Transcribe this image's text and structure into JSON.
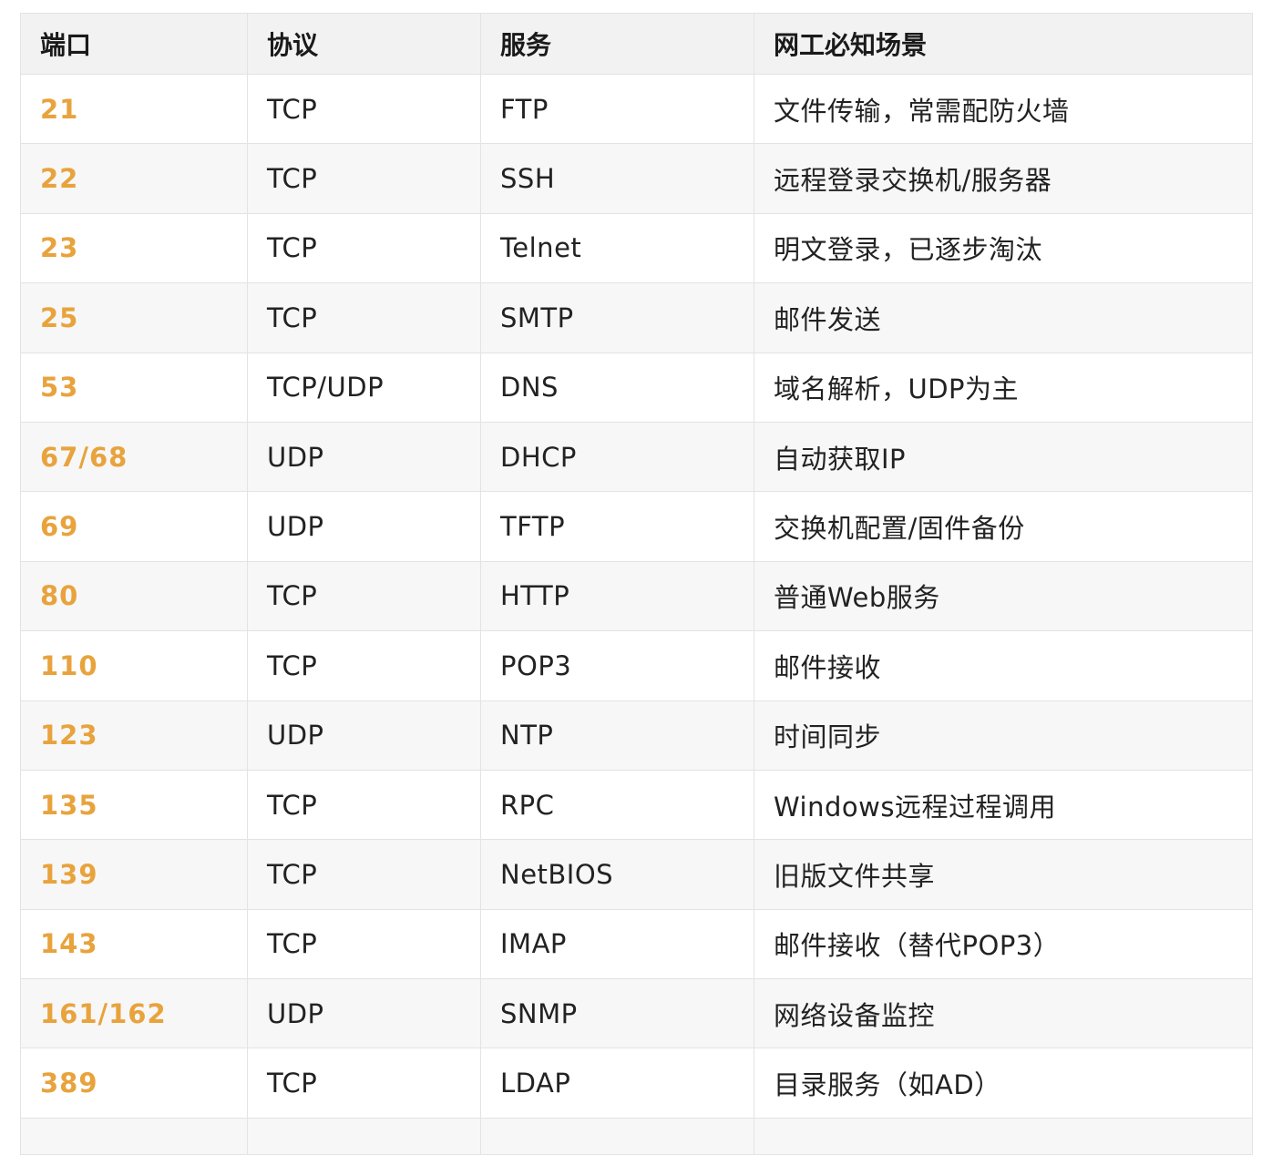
{
  "table": {
    "headers": [
      "端口",
      "协议",
      "服务",
      "网工必知场景"
    ],
    "accent_color": "#e8a33d",
    "rows": [
      {
        "port": "21",
        "protocol": "TCP",
        "service": "FTP",
        "scenario": "文件传输，常需配防火墙"
      },
      {
        "port": "22",
        "protocol": "TCP",
        "service": "SSH",
        "scenario": "远程登录交换机/服务器"
      },
      {
        "port": "23",
        "protocol": "TCP",
        "service": "Telnet",
        "scenario": "明文登录，已逐步淘汰"
      },
      {
        "port": "25",
        "protocol": "TCP",
        "service": "SMTP",
        "scenario": "邮件发送"
      },
      {
        "port": "53",
        "protocol": "TCP/UDP",
        "service": "DNS",
        "scenario": "域名解析，UDP为主"
      },
      {
        "port": "67/68",
        "protocol": "UDP",
        "service": "DHCP",
        "scenario": "自动获取IP"
      },
      {
        "port": "69",
        "protocol": "UDP",
        "service": "TFTP",
        "scenario": "交换机配置/固件备份"
      },
      {
        "port": "80",
        "protocol": "TCP",
        "service": "HTTP",
        "scenario": "普通Web服务"
      },
      {
        "port": "110",
        "protocol": "TCP",
        "service": "POP3",
        "scenario": "邮件接收"
      },
      {
        "port": "123",
        "protocol": "UDP",
        "service": "NTP",
        "scenario": "时间同步"
      },
      {
        "port": "135",
        "protocol": "TCP",
        "service": "RPC",
        "scenario": "Windows远程过程调用"
      },
      {
        "port": "139",
        "protocol": "TCP",
        "service": "NetBIOS",
        "scenario": "旧版文件共享"
      },
      {
        "port": "143",
        "protocol": "TCP",
        "service": "IMAP",
        "scenario": "邮件接收（替代POP3）"
      },
      {
        "port": "161/162",
        "protocol": "UDP",
        "service": "SNMP",
        "scenario": "网络设备监控"
      },
      {
        "port": "389",
        "protocol": "TCP",
        "service": "LDAP",
        "scenario": "目录服务（如AD）"
      }
    ]
  }
}
